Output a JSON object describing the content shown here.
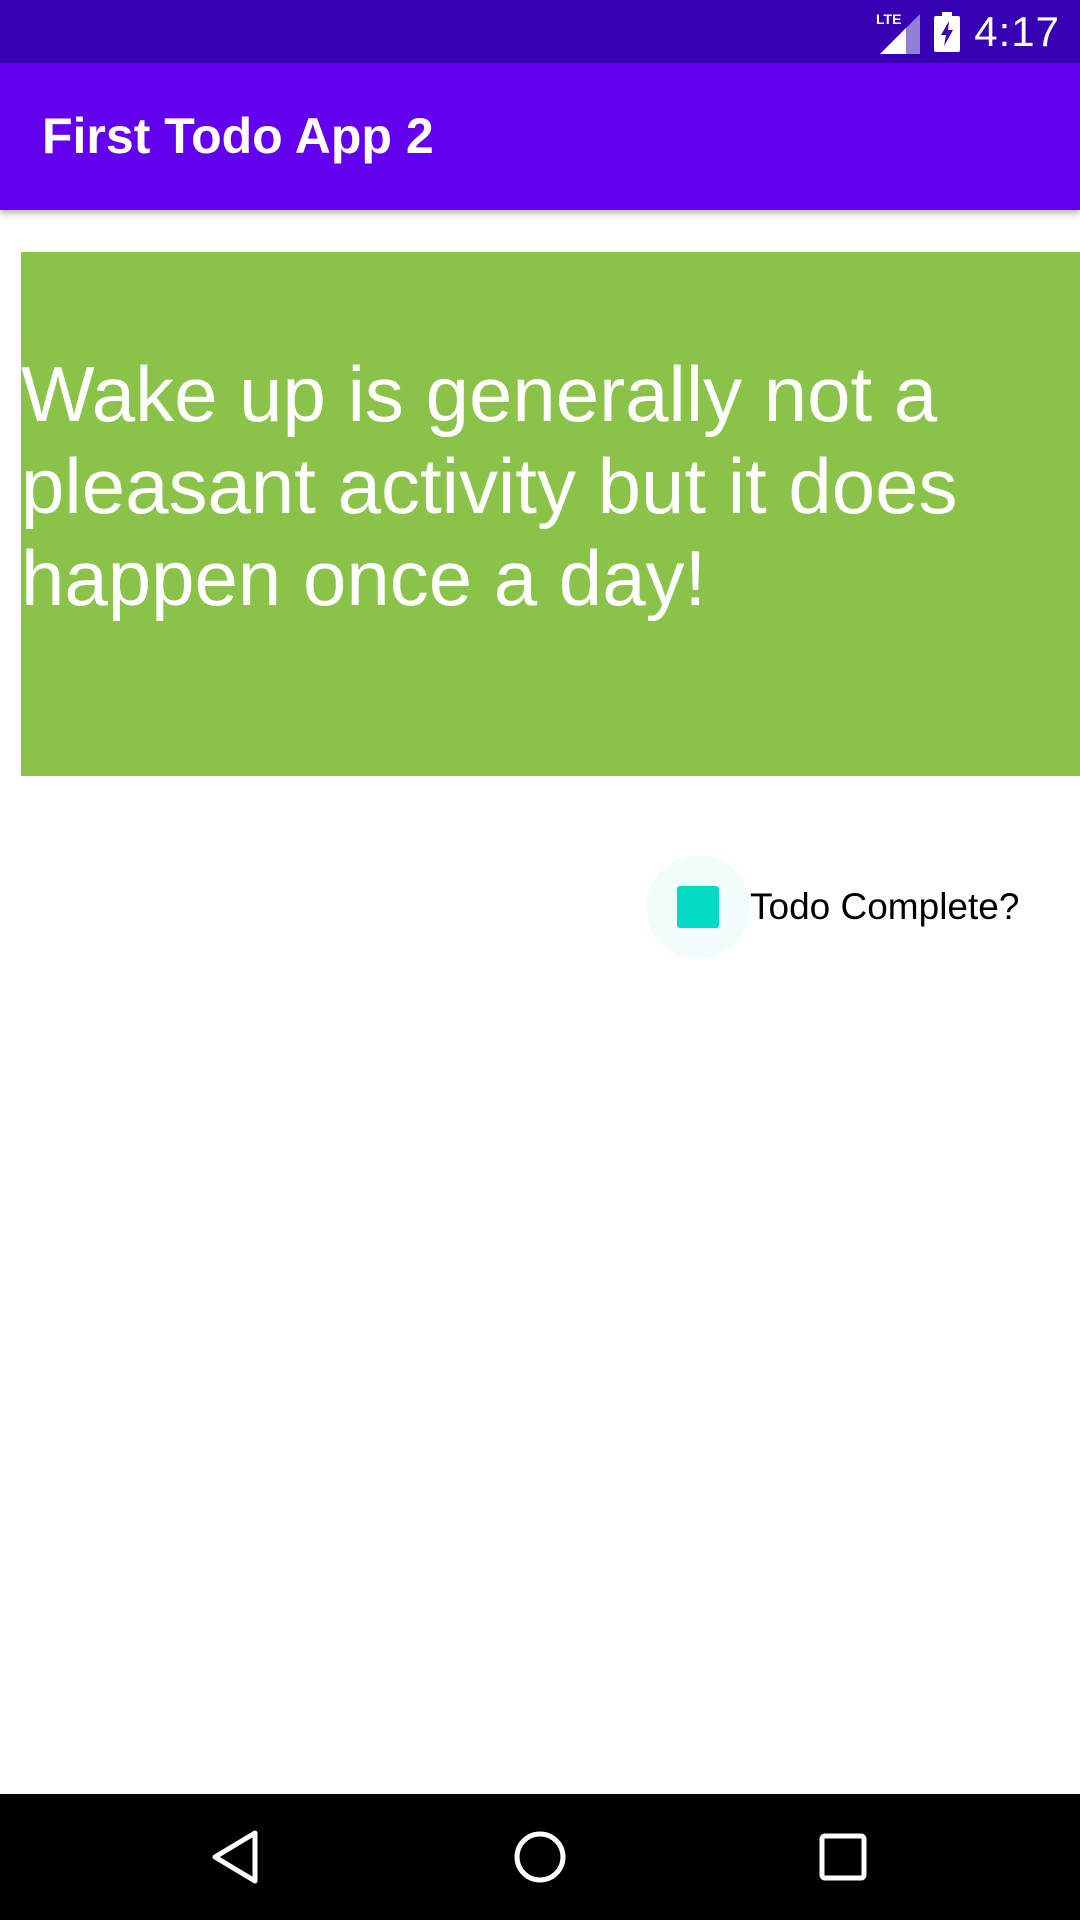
{
  "status_bar": {
    "time": "4:17",
    "network": "LTE",
    "icons": [
      "lte-signal-icon",
      "battery-charging-icon"
    ]
  },
  "app_bar": {
    "title": "First Todo App 2"
  },
  "todo": {
    "text": "Wake up is generally not a pleasant activity but it does happen once a day!",
    "background_color": "#8BC34A"
  },
  "checkbox": {
    "label": "Todo Complete?",
    "checked": false,
    "color": "#03DAC5"
  },
  "nav_bar": {
    "icons": [
      "back-icon",
      "home-icon",
      "recents-icon"
    ]
  },
  "colors": {
    "status_bar": "#3700B3",
    "primary": "#6200EE",
    "accent": "#03DAC5"
  }
}
